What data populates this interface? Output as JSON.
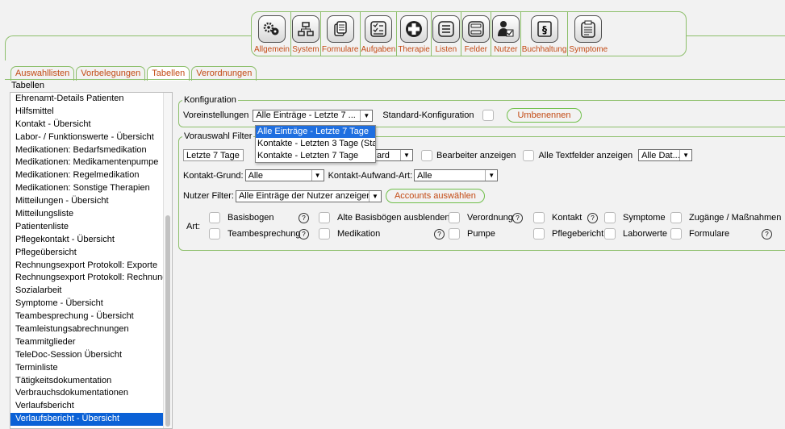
{
  "toolbar": {
    "items": [
      {
        "label": "Allgemein",
        "icon": "gears-icon"
      },
      {
        "label": "System",
        "icon": "network-icon"
      },
      {
        "label": "Formulare",
        "icon": "documents-icon"
      },
      {
        "label": "Aufgaben",
        "icon": "checklist-icon"
      },
      {
        "label": "Therapie",
        "icon": "medical-cross-icon"
      },
      {
        "label": "Listen",
        "icon": "list-icon"
      },
      {
        "label": "Felder",
        "icon": "fields-icon"
      },
      {
        "label": "Nutzer",
        "icon": "user-icon"
      },
      {
        "label": "Buchhaltung",
        "icon": "paragraph-icon"
      },
      {
        "label": "Symptome",
        "icon": "clipboard-icon"
      }
    ]
  },
  "tabs": [
    "Auswahllisten",
    "Vorbelegungen",
    "Tabellen",
    "Verordnungen"
  ],
  "active_tab": "Tabellen",
  "section_title": "Tabellen",
  "list_items": [
    "Ehrenamt-Details Patienten",
    "Hilfsmittel",
    "Kontakt - Übersicht",
    "Labor- / Funktionswerte - Übersicht",
    "Medikationen: Bedarfsmedikation",
    "Medikationen: Medikamentenpumpe",
    "Medikationen: Regelmedikation",
    "Medikationen: Sonstige Therapien",
    "Mitteilungen - Übersicht",
    "Mitteilungsliste",
    "Patientenliste",
    "Pflegekontakt - Übersicht",
    "Pflegeübersicht",
    "Rechnungsexport Protokoll: Exporte",
    "Rechnungsexport Protokoll: Rechnungen",
    "Sozialarbeit",
    "Symptome - Übersicht",
    "Teambesprechung - Übersicht",
    "Teamleistungsabrechnungen",
    "Teammitglieder",
    "TeleDoc-Session Übersicht",
    "Terminliste",
    "Tätigkeitsdokumentation",
    "Verbrauchsdokumentationen",
    "Verlaufsbericht",
    "Verlaufsbericht - Übersicht"
  ],
  "selected_item": "Verlaufsbericht - Übersicht",
  "konfiguration": {
    "legend": "Konfiguration",
    "voreinstellungen_label": "Voreinstellungen",
    "voreinstellungen_value": "Alle Einträge - Letzte 7 ...",
    "standard_label": "Standard-Konfiguration",
    "rename_button": "Umbenennen"
  },
  "dropdown_options": [
    "Alle Einträge - Letzte 7 Tage",
    "Kontakte - Letzten 3 Tage (Sta",
    "Kontakte - Letzten 7 Tage"
  ],
  "filter": {
    "legend": "Vorauswahl Filter",
    "zeitraum_value": "Letzte 7 Tage",
    "second_select_value": "ard",
    "bearbeiter_label": "Bearbeiter anzeigen",
    "textfelder_label": "Alle Textfelder anzeigen",
    "dat_select_value": "Alle Dat...",
    "kontakt_grund_label": "Kontakt-Grund:",
    "kontakt_grund_value": "Alle",
    "kontakt_aufwand_label": "Kontakt-Aufwand-Art:",
    "kontakt_aufwand_value": "Alle",
    "nutzer_label": "Nutzer Filter:",
    "nutzer_value": "Alle Einträge der Nutzer anzeigen",
    "accounts_button": "Accounts auswählen",
    "art_label": "Art:",
    "art_row1": [
      "Basisbogen",
      "Alte Basisbögen ausblenden",
      "Verordnung",
      "Kontakt",
      "Symptome",
      "Zugänge / Maßnahmen"
    ],
    "art_row2": [
      "Teambesprechung",
      "Medikation",
      "Pumpe",
      "Pflegebericht",
      "Laborwerte",
      "Formulare"
    ]
  }
}
